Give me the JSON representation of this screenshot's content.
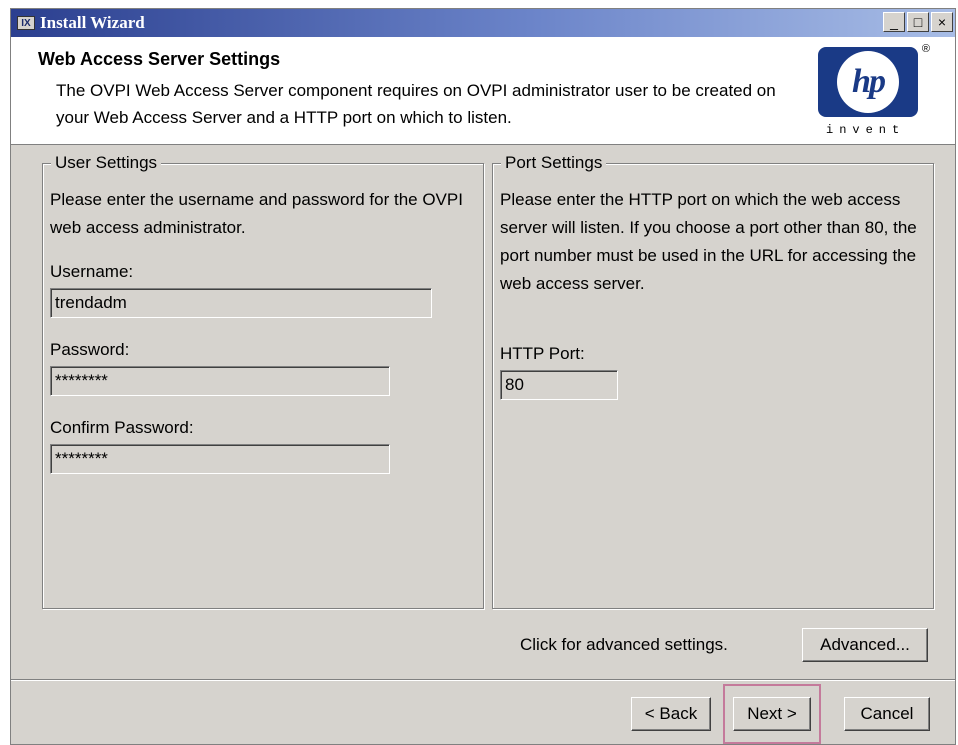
{
  "window": {
    "title": "Install Wizard",
    "icon_glyph": "IX",
    "minimize_glyph": "_",
    "maximize_glyph": "□",
    "close_glyph": "×"
  },
  "header": {
    "title": "Web Access Server Settings",
    "description": "The OVPI Web Access Server component requires on OVPI administrator user to be created on your Web Access Server and a HTTP port on which to listen.",
    "logo": {
      "text": "hp",
      "registered": "®",
      "tagline": "invent",
      "brand_color": "#1a3a86"
    }
  },
  "user_settings": {
    "legend": "User Settings",
    "instructions": "Please enter the username and password for the OVPI web access administrator.",
    "username_label": "Username:",
    "username_value": "trendadm",
    "password_label": "Password:",
    "password_value": "********",
    "confirm_label": "Confirm Password:",
    "confirm_value": "********"
  },
  "port_settings": {
    "legend": "Port Settings",
    "instructions": "Please enter the HTTP port on which the web access server will listen. If you choose a port other than 80, the port number must be used in the URL for accessing the web access server.",
    "port_label": "HTTP Port:",
    "port_value": "80"
  },
  "advanced": {
    "label": "Click for advanced settings.",
    "button": "Advanced..."
  },
  "footer": {
    "back": "< Back",
    "next": "Next >",
    "cancel": "Cancel"
  },
  "colors": {
    "titlebar_start": "#2b3f8f",
    "titlebar_end": "#a8bde6",
    "panel": "#d6d3ce",
    "focus": "#c47a9b"
  }
}
